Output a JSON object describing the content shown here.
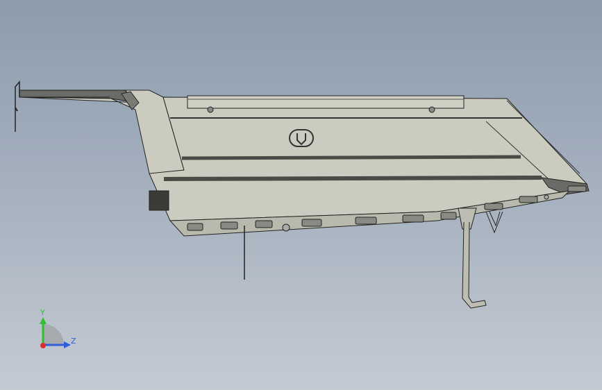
{
  "viewport": {
    "colors": {
      "background_top": "#8d9bad",
      "background_bottom": "#c4cad2",
      "body_fill": "#cbcbbf",
      "body_shade": "#b9b9ad",
      "edge": "#2a2a2a",
      "dark_strip": "#4a4a46"
    }
  },
  "triad": {
    "y_label": "Y",
    "z_label": "Z",
    "y_color": "#2fbf2f",
    "z_color": "#2f5fd8",
    "x_color": "#d82f2f"
  }
}
